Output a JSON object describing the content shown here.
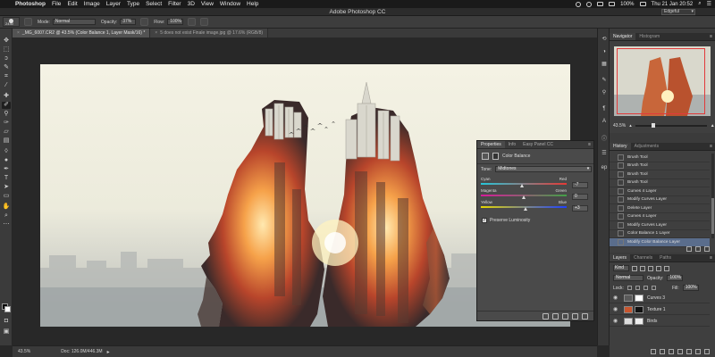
{
  "menubar": {
    "app_name": "Photoshop",
    "items": [
      "File",
      "Edit",
      "Image",
      "Layer",
      "Type",
      "Select",
      "Filter",
      "3D",
      "View",
      "Window",
      "Help"
    ],
    "battery": "100%",
    "clock": "Thu 21 Jan  20:52"
  },
  "window": {
    "title": "Adobe Photoshop CC",
    "workspace": "Edgeful"
  },
  "options_bar": {
    "brush_size": "2430",
    "mode_label": "Mode:",
    "mode_value": "Normal",
    "opacity_label": "Opacity:",
    "opacity_value": "37%",
    "flow_label": "Flow:",
    "flow_value": "100%"
  },
  "document_tabs": [
    {
      "label": "_MG_6007.CR2 @ 43.5% (Color Balance 1, Layer Mask/16) *",
      "active": true
    },
    {
      "label": "5 does not exist Finale image.jpg @ 17.6% (RGB/8)",
      "active": false
    }
  ],
  "statusbar": {
    "zoom": "43.5%",
    "doc_info": "Doc: 126.0M/446.3M"
  },
  "properties_panel": {
    "tabs": [
      "Properties",
      "Info",
      "Easy Panel CC"
    ],
    "title": "Color Balance",
    "tone_label": "Tone:",
    "tone_value": "Midtones",
    "sliders": [
      {
        "left": "Cyan",
        "right": "Red",
        "value": "-7",
        "gradient": [
          "#26c6d9",
          "#e53935"
        ]
      },
      {
        "left": "Magenta",
        "right": "Green",
        "value": "0",
        "gradient": [
          "#d81b9a",
          "#43a047"
        ]
      },
      {
        "left": "Yellow",
        "right": "Blue",
        "value": "+3",
        "gradient": [
          "#e6d800",
          "#1e40ff"
        ]
      }
    ],
    "preserve_label": "Preserve Luminosity"
  },
  "navigator": {
    "tabs": [
      "Navigator",
      "Histogram"
    ],
    "zoom": "43.5%"
  },
  "history": {
    "tabs": [
      "History",
      "Adjustments"
    ],
    "items": [
      "Brush Tool",
      "Brush Tool",
      "Brush Tool",
      "Brush Tool",
      "Curves 4 Layer",
      "Modify Curves Layer",
      "Delete Layer",
      "Curves 4 Layer",
      "Modify Curves Layer",
      "Color Balance 1 Layer",
      "Modify Color Balance Layer"
    ],
    "active_index": 10
  },
  "layers": {
    "tabs": [
      "Layers",
      "Channels",
      "Paths"
    ],
    "kind_label": "Kind",
    "blend_mode": "Normal",
    "opacity_label": "Opacity:",
    "opacity_value": "100%",
    "lock_label": "Lock:",
    "fill_label": "Fill:",
    "fill_value": "100%",
    "items": [
      "Curves 3",
      "Texture 1",
      "Birds"
    ]
  },
  "colors": {
    "accent_selection": "#5a6d8c",
    "ui_bg": "#3b3b3b"
  }
}
